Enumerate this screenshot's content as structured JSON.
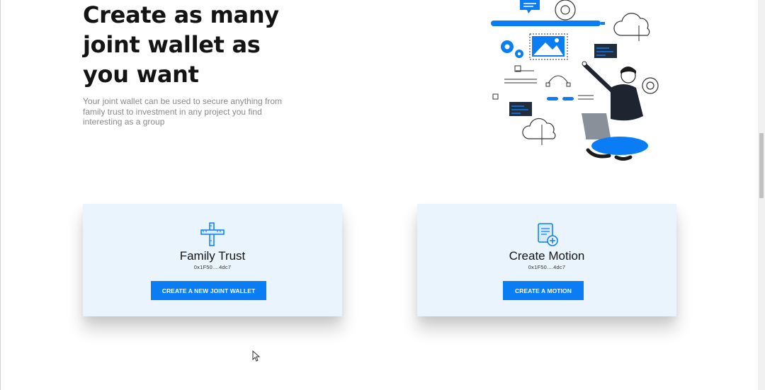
{
  "hero": {
    "title": "Create as many joint wallet as you want",
    "subtitle": "Your joint wallet can be used to secure anything from family trust to investment in any project you find interesting as a group"
  },
  "illustration": {
    "icon": "person-with-laptop-illustration"
  },
  "cards": [
    {
      "icon": "crossed-rulers-icon",
      "title": "Family Trust",
      "address": "0x1F50....4dc7",
      "button_label": "CREATE A NEW JOINT WALLET"
    },
    {
      "icon": "document-add-icon",
      "title": "Create Motion",
      "address": "0x1F50....4dc7",
      "button_label": "CREATE A MOTION"
    }
  ],
  "colors": {
    "accent": "#0a7cf4",
    "card_background": "#eaf4fd",
    "title_text": "#141414",
    "subtitle_text": "#8a8a8a"
  }
}
